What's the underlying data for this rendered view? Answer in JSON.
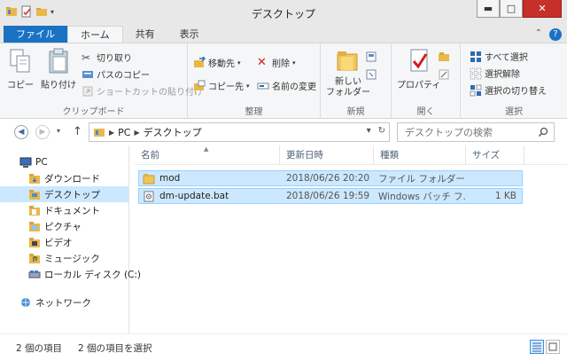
{
  "window": {
    "title": "デスクトップ",
    "minimize": "▬",
    "maximize": "□",
    "close": "✕"
  },
  "ribbon_tabs": [
    "ファイル",
    "ホーム",
    "共有",
    "表示"
  ],
  "ribbon": {
    "clipboard": {
      "label": "クリップボード",
      "copy": "コピー",
      "paste": "貼り付け",
      "cut": "切り取り",
      "copy_path": "パスのコピー",
      "paste_shortcut": "ショートカットの貼り付け"
    },
    "organize": {
      "label": "整理",
      "move_to": "移動先",
      "copy_to": "コピー先",
      "delete": "削除",
      "rename": "名前の変更"
    },
    "new": {
      "label": "新規",
      "new_folder": "新しい\nフォルダー"
    },
    "open": {
      "label": "開く",
      "properties": "プロパティ"
    },
    "select": {
      "label": "選択",
      "select_all": "すべて選択",
      "select_none": "選択解除",
      "invert": "選択の切り替え"
    }
  },
  "address": {
    "crumbs": [
      "PC",
      "デスクトップ"
    ],
    "search_placeholder": "デスクトップの検索"
  },
  "nav": {
    "items": [
      {
        "label": "PC",
        "icon": "pc-icon",
        "level": 0,
        "selected": false
      },
      {
        "label": "ダウンロード",
        "icon": "folder-icon",
        "level": 1,
        "selected": false
      },
      {
        "label": "デスクトップ",
        "icon": "folder-icon",
        "level": 1,
        "selected": true
      },
      {
        "label": "ドキュメント",
        "icon": "folder-icon",
        "level": 1,
        "selected": false
      },
      {
        "label": "ピクチャ",
        "icon": "folder-icon",
        "level": 1,
        "selected": false
      },
      {
        "label": "ビデオ",
        "icon": "folder-icon",
        "level": 1,
        "selected": false
      },
      {
        "label": "ミュージック",
        "icon": "folder-icon",
        "level": 1,
        "selected": false
      },
      {
        "label": "ローカル ディスク (C:)",
        "icon": "disk-icon",
        "level": 1,
        "selected": false
      }
    ],
    "network": "ネットワーク"
  },
  "columns": [
    "名前",
    "更新日時",
    "種類",
    "サイズ"
  ],
  "files": [
    {
      "name": "mod",
      "date": "2018/06/26 20:20",
      "type": "ファイル フォルダー",
      "size": "",
      "icon": "folder-icon"
    },
    {
      "name": "dm-update.bat",
      "date": "2018/06/26 19:59",
      "type": "Windows バッチ フ...",
      "size": "1 KB",
      "icon": "batch-file-icon"
    }
  ],
  "status": {
    "count": "2 個の項目",
    "selected": "2 個の項目を選択"
  },
  "colors": {
    "accent": "#1a72c4",
    "selection": "#cce8ff",
    "close": "#c7302a"
  }
}
